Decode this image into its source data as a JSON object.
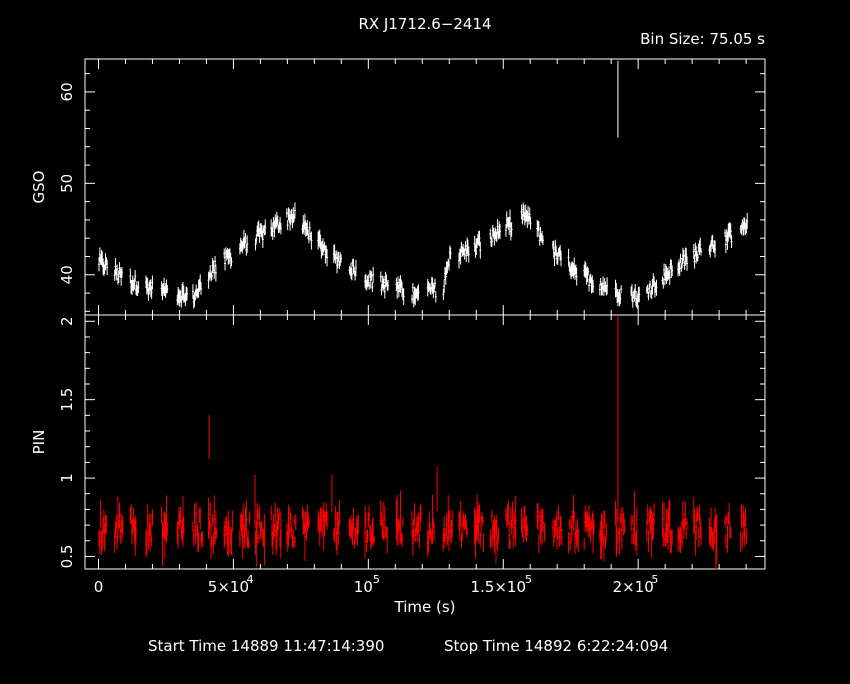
{
  "title": "RX J1712.6−2414",
  "bin_size": "Bin Size: 75.05 s",
  "footer": {
    "start": "Start Time 14889 11:47:14:390",
    "stop": "Stop Time 14892  6:22:24:094"
  },
  "colors": {
    "background": "#000000",
    "gso": "#ffffff",
    "pin": "#ff0000",
    "axis": "#ffffff"
  },
  "chart_data": [
    {
      "type": "scatter",
      "panel": "top",
      "ylabel": "GSO",
      "xlim": [
        -5000,
        247000
      ],
      "ylim": [
        35.6,
        63.6
      ],
      "ytick_values": [
        40,
        50,
        60
      ],
      "ytick_labels": [
        "40",
        "50",
        "60"
      ],
      "xtick_values": [
        0,
        50000,
        100000,
        150000,
        200000
      ],
      "xtick_labels": [
        "",
        "",
        "",
        "",
        ""
      ],
      "error_bars": true,
      "spike": {
        "x": 192500,
        "y": 59.2,
        "err": 4.2
      },
      "shape": {
        "x": [
          0,
          10000,
          20000,
          35000,
          42000,
          55000,
          72000,
          85000,
          100000,
          115000,
          128000,
          129000,
          145000,
          158000,
          170000,
          185000,
          200000,
          212000,
          225000,
          243000
        ],
        "y": [
          41.5,
          39.5,
          38.5,
          37.5,
          40.5,
          43.5,
          46.5,
          42.5,
          39.5,
          38.0,
          38.5,
          41.5,
          44.0,
          46.5,
          42.0,
          39.0,
          37.5,
          40.5,
          43.0,
          45.5
        ]
      }
    },
    {
      "type": "scatter",
      "panel": "bottom",
      "xlabel": "Time (s)",
      "ylabel": "PIN",
      "xlim": [
        -5000,
        247000
      ],
      "ylim": [
        0.42,
        2.04
      ],
      "ytick_values": [
        0.5,
        1,
        1.5,
        2
      ],
      "ytick_labels": [
        "0.5",
        "1",
        "1.5",
        "2"
      ],
      "xtick_values": [
        0,
        50000,
        100000,
        150000,
        200000
      ],
      "xtick_labels": [
        "0",
        "5×10",
        "10",
        "1.5×10",
        "2×10"
      ],
      "xtick_exponents": [
        "",
        "4",
        "5",
        "5",
        "5"
      ],
      "error_bars": true,
      "mean": 0.68,
      "spikes": [
        {
          "x": 41000,
          "y": 1.26,
          "err": 0.14
        },
        {
          "x": 58000,
          "y": 0.85,
          "err": 0.17
        },
        {
          "x": 86500,
          "y": 0.9,
          "err": 0.12
        },
        {
          "x": 125500,
          "y": 0.93,
          "err": 0.14
        },
        {
          "x": 192500,
          "y": 1.4,
          "err": 0.65
        }
      ]
    }
  ]
}
